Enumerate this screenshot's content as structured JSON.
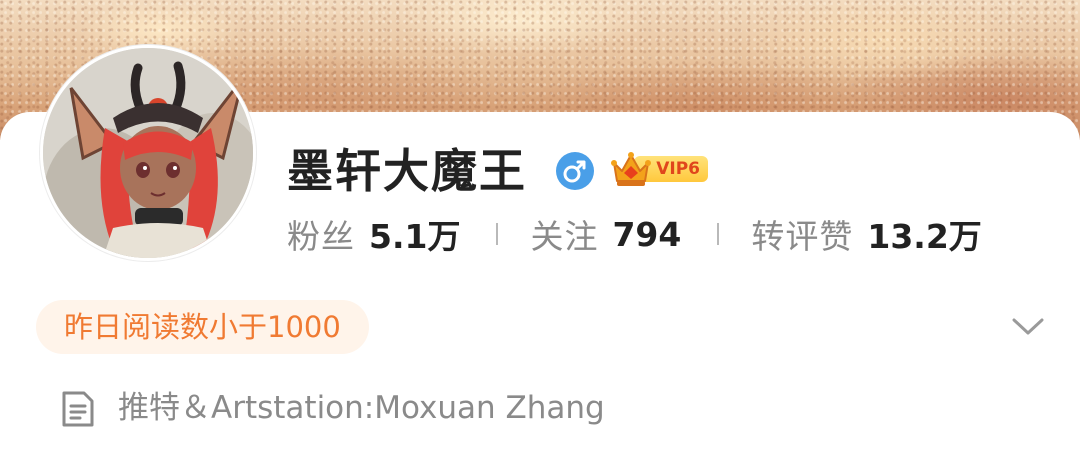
{
  "banner": {
    "description_colors": [
      "#f3dcc0",
      "#d9a47a",
      "#c98c66"
    ]
  },
  "profile": {
    "username": "墨轩大魔王",
    "gender_icon": "male-icon",
    "vip": {
      "label": "VIP6",
      "icon": "crown-icon"
    },
    "stats": [
      {
        "label": "粉丝",
        "value": "5.1万"
      },
      {
        "label": "关注",
        "value": "794"
      },
      {
        "label": "转评赞",
        "value": "13.2万"
      }
    ],
    "reads_badge": "昨日阅读数小于1000",
    "bio_icon": "document-icon",
    "bio": "推特＆Artstation:Moxuan Zhang"
  },
  "colors": {
    "accent_orange": "#f07a32",
    "reads_bg": "#fff4ea",
    "gender_blue": "#4a9fe8",
    "vip_gold": "#ffc83d",
    "text_primary": "#222222",
    "text_secondary": "#8a8a8a"
  }
}
